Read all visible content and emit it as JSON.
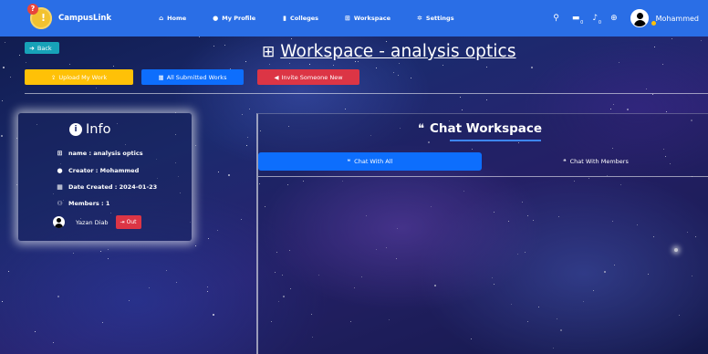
{
  "navbar": {
    "brand": "CampusLink",
    "links": [
      {
        "label": "Home",
        "icon": "home-icon",
        "glyph": "⌂"
      },
      {
        "label": "My Profile",
        "icon": "user-icon",
        "glyph": "●"
      },
      {
        "label": "Colleges",
        "icon": "building-icon",
        "glyph": "▮"
      },
      {
        "label": "Workspace",
        "icon": "sitemap-icon",
        "glyph": "⊞"
      },
      {
        "label": "Settings",
        "icon": "gears-icon",
        "glyph": "✲"
      }
    ],
    "notifications": {
      "messages_count": "0",
      "alerts_count": "0"
    },
    "user_name": "Mohammed"
  },
  "page": {
    "back_label": "Back",
    "title": "Workspace - analysis optics",
    "upload_label": "Upload My Work",
    "submitted_label": "All Submitted Works",
    "invite_label": "Invite Someone New"
  },
  "info": {
    "heading": "Info",
    "name": "name : analysis optics",
    "creator": "Creator : Mohammed",
    "date_created": "Date Created : 2024-01-23",
    "members": "Members : 1",
    "member_list": [
      {
        "name": "Yazan Diab",
        "out_label": "Out"
      }
    ]
  },
  "chat": {
    "heading": "Chat Workspace",
    "tab_all": "Chat With All",
    "tab_members": "Chat With Members"
  },
  "colors": {
    "navbar": "#2a6ee6",
    "back": "#17a2b8",
    "upload": "#ffc107",
    "submitted": "#0d6efd",
    "invite": "#dc3545"
  }
}
